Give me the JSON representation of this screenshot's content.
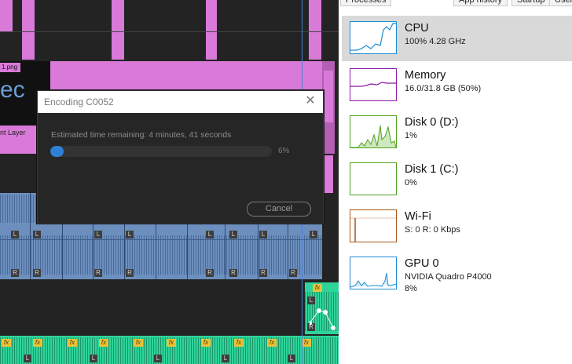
{
  "timeline": {
    "clip_label_png": "1.png",
    "clip_label_text": "ec",
    "clip_label_layer": "nt Layer",
    "track_badges": {
      "fx": "fx",
      "left": "L",
      "right": "R"
    }
  },
  "dialog": {
    "title": "Encoding C0052",
    "close_glyph": "✕",
    "status": "Estimated time remaining: 4 minutes, 41 seconds",
    "progress": 0.06,
    "percent_label": "6%",
    "cancel_label": "Cancel",
    "accent": "#2f7fd6"
  },
  "task_manager": {
    "tabs": [
      "Processes",
      "App history",
      "Startup",
      "Users"
    ],
    "items": [
      {
        "name": "CPU",
        "line1": "100%  4.28 GHz",
        "line2": "",
        "color": "#1b8ad3"
      },
      {
        "name": "Memory",
        "line1": "16.0/31.8 GB (50%)",
        "line2": "",
        "color": "#8b1aa6"
      },
      {
        "name": "Disk 0 (D:)",
        "line1": "1%",
        "line2": "",
        "color": "#4ea31c"
      },
      {
        "name": "Disk 1 (C:)",
        "line1": "0%",
        "line2": "",
        "color": "#4ea31c"
      },
      {
        "name": "Wi-Fi",
        "line1": "S: 0  R: 0 Kbps",
        "line2": "",
        "color": "#a7581c"
      },
      {
        "name": "GPU 0",
        "line1": "NVIDIA Quadro P4000",
        "line2": "8%",
        "color": "#1b8ad3"
      }
    ]
  }
}
